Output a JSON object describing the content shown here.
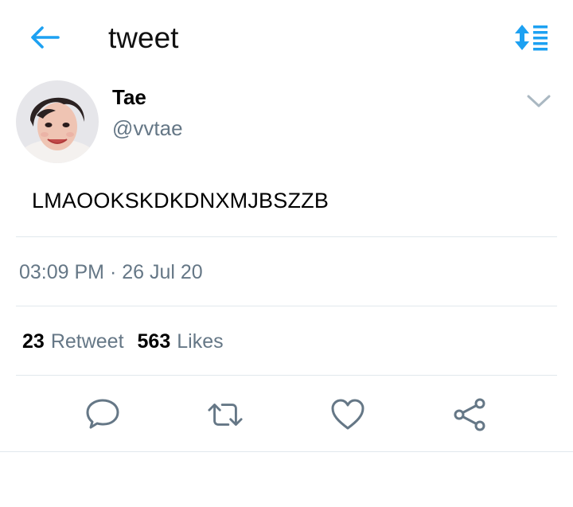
{
  "header": {
    "title": "tweet",
    "back_icon": "arrow-left-icon",
    "sort_icon": "sort-lines-icon",
    "accent_color": "#1da1f2"
  },
  "tweet": {
    "display_name": "Tae",
    "handle": "@vvtae",
    "text": "LMAOOKSKDKDNXMJBSZZB",
    "timestamp": "03:09 PM · 26 Jul 20",
    "retweet_count": "23",
    "retweet_label": "Retweet",
    "like_count": "563",
    "like_label": "Likes"
  },
  "actions": [
    {
      "name": "reply",
      "icon": "speech-bubble-icon"
    },
    {
      "name": "retweet",
      "icon": "retweet-icon"
    },
    {
      "name": "like",
      "icon": "heart-icon"
    },
    {
      "name": "share",
      "icon": "share-icon"
    }
  ],
  "colors": {
    "secondary_text": "#657786",
    "icon_gray": "#657786",
    "divider": "#e1e8ed"
  }
}
